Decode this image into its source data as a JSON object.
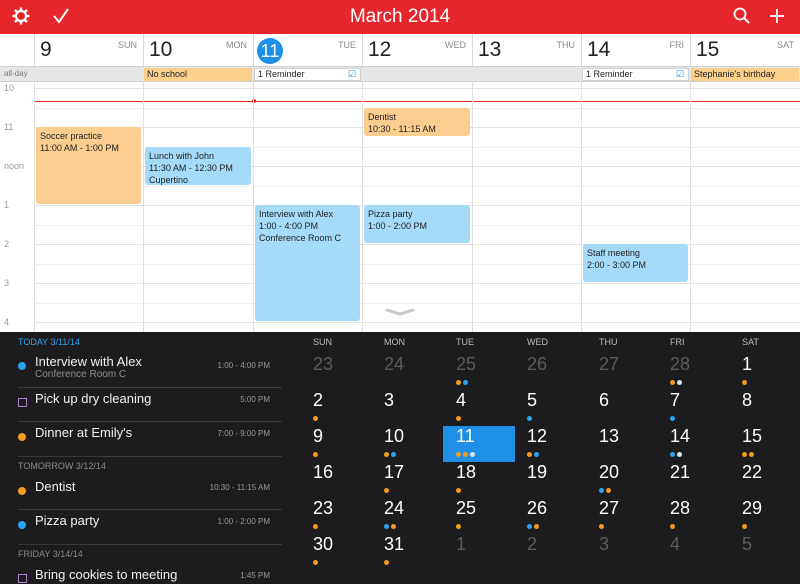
{
  "colors": {
    "brand_red": "#e5262b",
    "today_blue": "#1e8fe6",
    "event_orange": "#fbce8f",
    "event_blue": "#a5daf9",
    "dark_panel": "#1c1c1e",
    "dot_orange": "#f39a1f",
    "dot_blue": "#2aa3f0",
    "dot_white": "#d6e6ef"
  },
  "topbar": {
    "title": "March 2014",
    "left_icons": [
      "gear-icon",
      "checkmark-icon"
    ],
    "right_icons": [
      "search-icon",
      "plus-icon"
    ]
  },
  "week": {
    "days": [
      {
        "num": "9",
        "name": "SUN"
      },
      {
        "num": "10",
        "name": "MON"
      },
      {
        "num": "11",
        "name": "TUE",
        "today": true
      },
      {
        "num": "12",
        "name": "WED"
      },
      {
        "num": "13",
        "name": "THU"
      },
      {
        "num": "14",
        "name": "FRI"
      },
      {
        "num": "15",
        "name": "SAT"
      }
    ],
    "allday_label": "all-day",
    "allday_events": [
      {
        "day": 1,
        "title": "No school",
        "style": "orange"
      },
      {
        "day": 2,
        "title": "1 Reminder",
        "style": "white",
        "checkbox": true
      },
      {
        "day": 5,
        "title": "1 Reminder",
        "style": "white",
        "checkbox": true
      },
      {
        "day": 6,
        "title": "Stephanie's birthday",
        "style": "orange"
      }
    ],
    "hour_labels": [
      "10",
      "11",
      "noon",
      "1",
      "2",
      "3",
      "4"
    ],
    "events": [
      {
        "day": 0,
        "title": "Soccer practice",
        "time": "11:00 AM - 1:00 PM",
        "location": "",
        "start": 11.0,
        "end": 13.0,
        "color": "orange"
      },
      {
        "day": 1,
        "title": "Lunch with John",
        "time": "11:30 AM - 12:30 PM",
        "location": "Cupertino",
        "start": 11.5,
        "end": 12.5,
        "color": "blue"
      },
      {
        "day": 2,
        "title": "Interview with Alex",
        "time": "1:00 - 4:00 PM",
        "location": "Conference Room C",
        "start": 13.0,
        "end": 16.0,
        "color": "blue"
      },
      {
        "day": 3,
        "title": "Dentist",
        "time": "10:30 - 11:15 AM",
        "location": "",
        "start": 10.5,
        "end": 11.25,
        "color": "orange"
      },
      {
        "day": 3,
        "title": "Pizza party",
        "time": "1:00 - 2:00 PM",
        "location": "",
        "start": 13.0,
        "end": 14.0,
        "color": "blue"
      },
      {
        "day": 5,
        "title": "Staff meeting",
        "time": "2:00 - 3:00 PM",
        "location": "",
        "start": 14.0,
        "end": 15.0,
        "color": "blue"
      }
    ]
  },
  "agenda": {
    "sections": [
      {
        "label": "TODAY",
        "date": "3/11/14",
        "today": true,
        "items": [
          {
            "title": "Interview with Alex",
            "sub": "Conference Room C",
            "time": "1:00 - 4:00 PM",
            "marker": "dot",
            "color": "#2aa3f0"
          },
          {
            "title": "Pick up dry cleaning",
            "sub": "",
            "time": "5:00 PM",
            "marker": "square",
            "color": "#b37fd1"
          },
          {
            "title": "Dinner at Emily's",
            "sub": "",
            "time": "7:00 - 9:00 PM",
            "marker": "dot",
            "color": "#f39a1f"
          }
        ]
      },
      {
        "label": "TOMORROW",
        "date": "3/12/14",
        "today": false,
        "items": [
          {
            "title": "Dentist",
            "sub": "",
            "time": "10:30 - 11:15 AM",
            "marker": "dot",
            "color": "#f39a1f"
          },
          {
            "title": "Pizza party",
            "sub": "",
            "time": "1:00 - 2:00 PM",
            "marker": "dot",
            "color": "#2aa3f0"
          }
        ]
      },
      {
        "label": "FRIDAY",
        "date": "3/14/14",
        "today": false,
        "items": [
          {
            "title": "Bring cookies to meeting",
            "sub": "",
            "time": "1:45 PM",
            "marker": "square",
            "color": "#b37fd1"
          }
        ]
      }
    ]
  },
  "month": {
    "weekdays": [
      "SUN",
      "MON",
      "TUE",
      "WED",
      "THU",
      "FRI",
      "SAT"
    ],
    "weeks": [
      [
        {
          "n": "23",
          "dim": true,
          "dots": []
        },
        {
          "n": "24",
          "dim": true,
          "dots": []
        },
        {
          "n": "25",
          "dim": true,
          "dots": [
            "o",
            "b"
          ]
        },
        {
          "n": "26",
          "dim": true,
          "dots": []
        },
        {
          "n": "27",
          "dim": true,
          "dots": []
        },
        {
          "n": "28",
          "dim": true,
          "dots": [
            "o",
            "w"
          ]
        },
        {
          "n": "1",
          "dots": [
            "o"
          ]
        }
      ],
      [
        {
          "n": "2",
          "dots": [
            "o"
          ]
        },
        {
          "n": "3",
          "dots": []
        },
        {
          "n": "4",
          "dots": [
            "o"
          ]
        },
        {
          "n": "5",
          "dots": [
            "b"
          ]
        },
        {
          "n": "6",
          "dots": []
        },
        {
          "n": "7",
          "dots": [
            "b"
          ]
        },
        {
          "n": "8",
          "dots": []
        }
      ],
      [
        {
          "n": "9",
          "dots": [
            "o"
          ]
        },
        {
          "n": "10",
          "dots": [
            "o",
            "b"
          ]
        },
        {
          "n": "11",
          "sel": true,
          "dots": [
            "o",
            "o",
            "w"
          ]
        },
        {
          "n": "12",
          "dots": [
            "o",
            "b"
          ]
        },
        {
          "n": "13",
          "dots": []
        },
        {
          "n": "14",
          "dots": [
            "b",
            "w"
          ]
        },
        {
          "n": "15",
          "dots": [
            "o",
            "o"
          ]
        }
      ],
      [
        {
          "n": "16",
          "dots": []
        },
        {
          "n": "17",
          "dots": [
            "o"
          ]
        },
        {
          "n": "18",
          "dots": [
            "o"
          ]
        },
        {
          "n": "19",
          "dots": []
        },
        {
          "n": "20",
          "dots": [
            "b",
            "o"
          ]
        },
        {
          "n": "21",
          "dots": []
        },
        {
          "n": "22",
          "dots": []
        }
      ],
      [
        {
          "n": "23",
          "dots": [
            "o"
          ]
        },
        {
          "n": "24",
          "dots": [
            "b",
            "o"
          ]
        },
        {
          "n": "25",
          "dots": [
            "o"
          ]
        },
        {
          "n": "26",
          "dots": [
            "b",
            "o"
          ]
        },
        {
          "n": "27",
          "dots": [
            "o"
          ]
        },
        {
          "n": "28",
          "dots": [
            "o"
          ]
        },
        {
          "n": "29",
          "dots": [
            "o"
          ]
        }
      ],
      [
        {
          "n": "30",
          "dots": [
            "o"
          ]
        },
        {
          "n": "31",
          "dots": [
            "o"
          ]
        },
        {
          "n": "1",
          "dim": true,
          "dots": []
        },
        {
          "n": "2",
          "dim": true,
          "dots": []
        },
        {
          "n": "3",
          "dim": true,
          "dots": []
        },
        {
          "n": "4",
          "dim": true,
          "dots": []
        },
        {
          "n": "5",
          "dim": true,
          "dots": []
        }
      ]
    ]
  }
}
